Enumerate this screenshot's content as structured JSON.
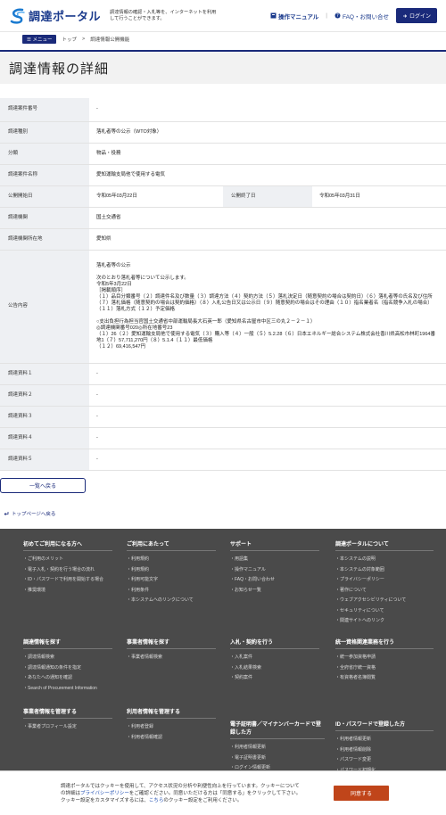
{
  "header": {
    "logo_text": "調達ポータル",
    "tagline": "調達情報の確認・入札等を、インターネットを利用して行うことができます。",
    "manual": "操作マニュアル",
    "faq": "FAQ・お問い合せ",
    "login": "ログイン"
  },
  "breadcrumb": {
    "menu": "メニュー",
    "top": "トップ",
    "current": "調達情報公開機能"
  },
  "page_title": "調達情報の詳細",
  "table": {
    "case_no_label": "調達案件番号",
    "case_no": "-",
    "type_label": "調達種別",
    "type": "落札者等の公示（WTO対象）",
    "category_label": "分類",
    "category": "物品・役務",
    "name_label": "調達案件名称",
    "name": "愛知運輸支局他で使用する電気",
    "pub_start_label": "公開開始日",
    "pub_start": "令和05年03月22日",
    "pub_end_label": "公開終了日",
    "pub_end": "令和05年03月31日",
    "org_label": "調達機関",
    "org": "国土交通省",
    "location_label": "調達機関所在地",
    "location": "愛知県",
    "notice_label": "公告内容",
    "notice": "落札者等の公示\n\n次のとおり落札者等について公示します。\n令和5年3月22日\n［掲載順序］\n（１）品目分類番号（２）調達件名及び数量（３）調達方法（４）契約方法（５）落札決定日（随意契約の場合は契約日）（６）落札者等の氏名及び住所（７）落札価格（随意契約の場合は契約価格）（８）入札公告日又は公示日（９）随意契約の場合はその理由（１０）指名業者名（指名競争入札の場合）（１１）落札方式（１２）予定価格\n\n○支出負担行為担当官国土交通省中部運輸局長大石英一郎（愛知県名古屋市中区三の丸２－２－１）\n◎調達機関番号020◎所在地番号23\n（１）26（２）愛知運輸支局他で使用する電気（３）購入等（４）一般（５）5.2.28（６）日本エネルギー総合システム株式会社香川県高松市林町1964番地1（７）57,711,270円（８）5.1.4（１１）最低価格\n（１２）69,416,547円",
    "doc1_label": "調達資料１",
    "doc1": "-",
    "doc2_label": "調達資料２",
    "doc2": "-",
    "doc3_label": "調達資料３",
    "doc3": "-",
    "doc4_label": "調達資料４",
    "doc4": "-",
    "doc5_label": "調達資料５",
    "doc5": "-"
  },
  "back_button": "一覧へ戻る",
  "top_link": "トップページへ戻る",
  "footer": {
    "c1": {
      "title": "初めてご利用になる方へ",
      "items": [
        "ご利用のメリット",
        "電子入札・契約を行う場合の流れ",
        "ID・パスワードで利用を開始する場合",
        "推奨環境"
      ]
    },
    "c2": {
      "title": "ご利用にあたって",
      "items": [
        "利用規約",
        "利用規約",
        "利用可能文字",
        "利用条件",
        "本システムへのリンクについて"
      ]
    },
    "c3": {
      "title": "サポート",
      "items": [
        "用語集",
        "操作マニュアル",
        "FAQ・お問い合わせ",
        "お知らせ一覧"
      ]
    },
    "c4": {
      "title": "調達ポータルについて",
      "items": [
        "本システムの説明",
        "本システムの対象範囲",
        "プライバシーポリシー",
        "著作について",
        "ウェブアクセシビリティについて",
        "セキュリティについて",
        "関連サイトへのリンク"
      ]
    },
    "c5": {
      "title": "調達情報を探す",
      "items": [
        "調達情報検索",
        "調達情報通知の条件を指定",
        "あなたへの通知を確認",
        "Search of Procurement Information"
      ]
    },
    "c6": {
      "title": "事業者情報を探す",
      "items": [
        "事業者情報検索"
      ]
    },
    "c7": {
      "title": "入札・契約を行う",
      "items": [
        "入札案件",
        "入札結果検索",
        "契約案件"
      ]
    },
    "c8": {
      "title": "統一資格関連業務を行う",
      "items": [
        "統一参加資格申請",
        "全府省庁統一資格",
        "有資格者名簿閲覧"
      ]
    },
    "c9": {
      "title": "事業者情報を管理する",
      "items": [
        "事業者プロフィール設定"
      ]
    },
    "c10": {
      "title": "利用者情報を管理する",
      "items": [
        "利用者登録",
        "利用者情報確認"
      ]
    },
    "c11": {
      "title": "電子証明書／マイナンバーカードで登録した方",
      "items": [
        "利用者情報更新",
        "電子証明書更新",
        "ログイン情報更新"
      ]
    },
    "c12": {
      "title": "ID・パスワードで登録した方",
      "items": [
        "利用者情報更新",
        "利用者情報削除",
        "パスワード変更",
        "パスワード初期化"
      ]
    }
  },
  "cookie": {
    "text1": "調達ポータルではクッキーを使用して、アクセス状況の分析や利便性向上を行っています。クッキーについての詳細は",
    "privacy": "プライバシーポリシー",
    "text2": "をご確認ください。同意いただける方は「同意する」をクリックして下さい。クッキー設定をカスタマイズするには、",
    "here": "こちら",
    "text3": "のクッキー設定をご利用ください。",
    "agree": "同意する"
  }
}
